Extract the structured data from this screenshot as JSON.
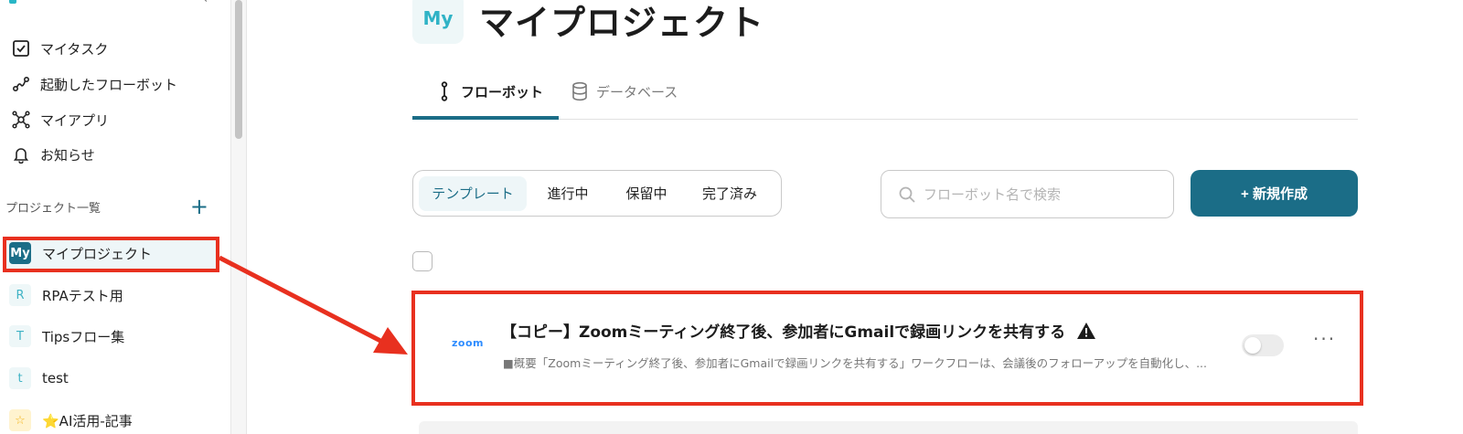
{
  "sidebar": {
    "nav": [
      {
        "label": "マイタスク",
        "icon": "checkbox-icon"
      },
      {
        "label": "起動したフローボット",
        "icon": "flow-icon"
      },
      {
        "label": "マイアプリ",
        "icon": "network-icon"
      },
      {
        "label": "お知らせ",
        "icon": "bell-icon"
      }
    ],
    "projects_header": "プロジェクト一覧",
    "add_symbol": "+",
    "projects": [
      {
        "badge": "My",
        "label": "マイプロジェクト"
      },
      {
        "badge": "R",
        "label": "RPAテスト用"
      },
      {
        "badge": "T",
        "label": "Tipsフロー集"
      },
      {
        "badge": "t",
        "label": "test"
      },
      {
        "badge": "☆",
        "label": "⭐AI活用-記事"
      }
    ]
  },
  "main": {
    "title_badge": "My",
    "title": "マイプロジェクト",
    "tabs": [
      {
        "label": "フローボット",
        "active": true
      },
      {
        "label": "データベース",
        "active": false
      }
    ],
    "filters": [
      "テンプレート",
      "進行中",
      "保留中",
      "完了済み"
    ],
    "search": {
      "placeholder": "フローボット名で検索",
      "value": ""
    },
    "new_button": "+ 新規作成",
    "flows": [
      {
        "app_logo": "zoom",
        "title": "【コピー】Zoomミーティング終了後、参加者にGmailで録画リンクを共有する",
        "description": "■概要「Zoomミーティング終了後、参加者にGmailで録画リンクを共有する」ワークフローは、会議後のフォローアップを自動化し、...",
        "enabled": false,
        "more": "···"
      }
    ]
  },
  "colors": {
    "accent": "#1b6d87",
    "highlight": "#e8301f",
    "badge_text": "#30b3c6"
  }
}
